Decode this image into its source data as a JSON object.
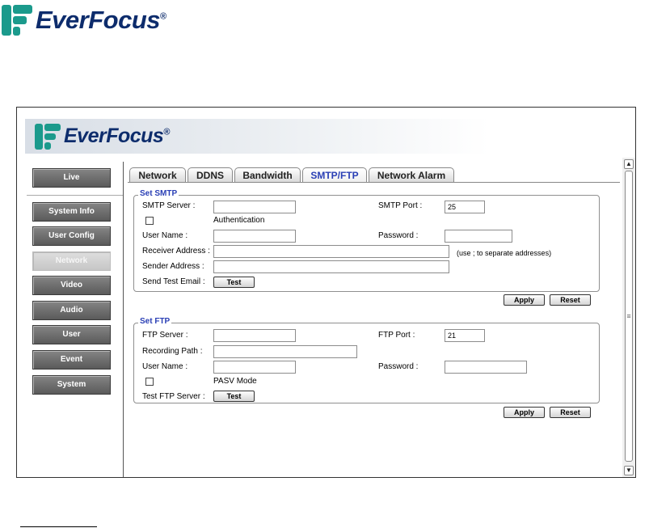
{
  "brand": {
    "name": "EverFocus",
    "mark": "®",
    "color": "#1b9a8c",
    "text_color": "#0d2c6c"
  },
  "menu": [
    {
      "label": "Live",
      "active": false
    },
    {
      "label": "System Info",
      "active": false
    },
    {
      "label": "User Config",
      "active": false
    },
    {
      "label": "Network",
      "active": true
    },
    {
      "label": "Video",
      "active": false
    },
    {
      "label": "Audio",
      "active": false
    },
    {
      "label": "User",
      "active": false
    },
    {
      "label": "Event",
      "active": false
    },
    {
      "label": "System",
      "active": false
    }
  ],
  "tabs": [
    {
      "label": "Network"
    },
    {
      "label": "DDNS"
    },
    {
      "label": "Bandwidth"
    },
    {
      "label": "SMTP/FTP"
    },
    {
      "label": "Network Alarm"
    }
  ],
  "smtp": {
    "legend": "Set SMTP",
    "server_label": "SMTP Server :",
    "server_value": "",
    "port_label": "SMTP Port :",
    "port_value": "25",
    "auth_label": "Authentication",
    "user_label": "User Name :",
    "user_value": "",
    "password_label": "Password :",
    "password_value": "",
    "receiver_label": "Receiver Address :",
    "receiver_value": "",
    "receiver_hint": "(use ; to separate addresses)",
    "sender_label": "Sender Address :",
    "sender_value": "",
    "test_label": "Send Test Email :",
    "test_button": "Test"
  },
  "ftp": {
    "legend": "Set FTP",
    "server_label": "FTP Server :",
    "server_value": "",
    "port_label": "FTP Port :",
    "port_value": "21",
    "path_label": "Recording Path :",
    "path_value": "",
    "user_label": "User Name :",
    "user_value": "",
    "password_label": "Password :",
    "password_value": "",
    "pasv_label": "PASV Mode",
    "test_label": "Test FTP Server :",
    "test_button": "Test"
  },
  "actions": {
    "apply": "Apply",
    "reset": "Reset"
  },
  "colors": {
    "accent": "#2a3fb5",
    "menu": "#6e6e6e"
  }
}
